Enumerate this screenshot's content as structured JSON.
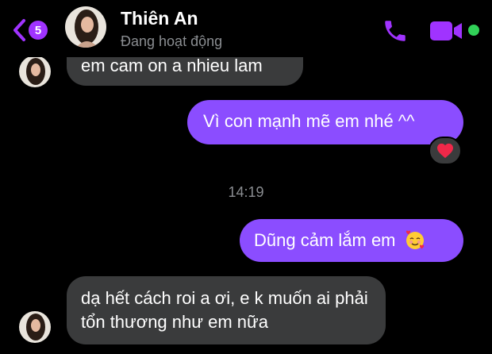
{
  "header": {
    "back_count": "5",
    "contact_name": "Thiên An",
    "status": "Đang hoạt động",
    "accent": "#a033ff",
    "online_color": "#31d158"
  },
  "messages": [
    {
      "direction": "incoming",
      "text": "em cam on a nhieu lam"
    },
    {
      "direction": "outgoing",
      "text": "Vì con mạnh mẽ em nhé ^^",
      "reaction": "heart"
    },
    {
      "direction": "outgoing",
      "text": "Dũng cảm lắm em",
      "emoji": "smiling-face-with-hearts"
    },
    {
      "direction": "incoming",
      "text": "dạ hết cách roi a ơi, e k muốn ai phải tổn thương như em nữa"
    }
  ],
  "timestamp": "14:19",
  "colors": {
    "outgoing_bubble": "#8b4dff",
    "incoming_bubble": "#3a3b3c",
    "background": "#000000"
  }
}
